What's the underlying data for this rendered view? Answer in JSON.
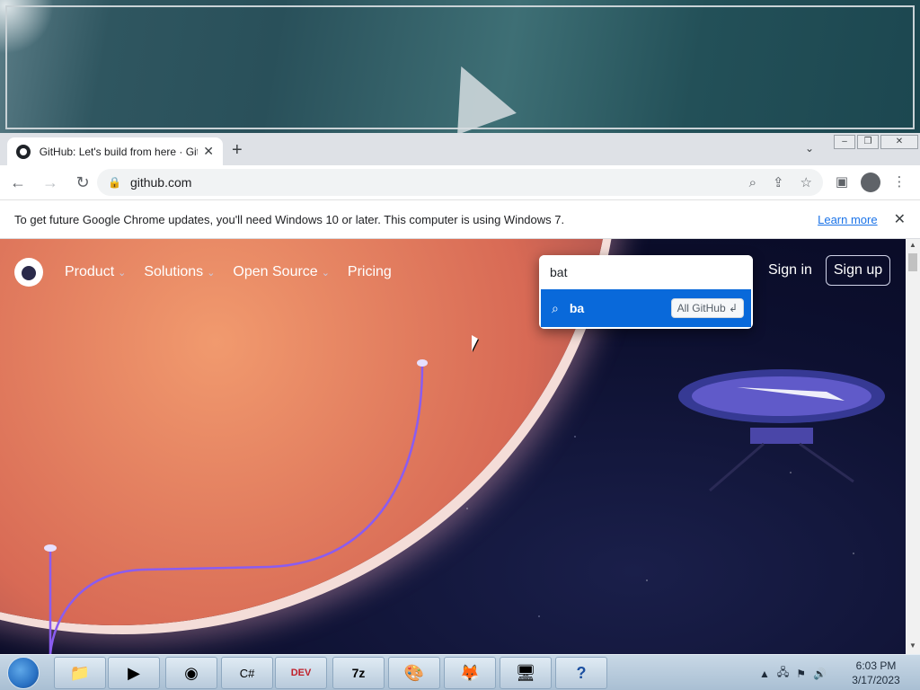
{
  "browser": {
    "tab_title": "GitHub: Let's build from here · GitHub",
    "tab_close": "✕",
    "new_tab": "+",
    "tab_menu": "⌄",
    "url": "github.com",
    "infobar_text": "To get future Google Chrome updates, you'll need Windows 10 or later. This computer is using Windows 7.",
    "infobar_link": "Learn more",
    "infobar_close": "✕"
  },
  "github": {
    "nav": [
      {
        "label": "Product",
        "caret": "⌄"
      },
      {
        "label": "Solutions",
        "caret": "⌄"
      },
      {
        "label": "Open Source",
        "caret": "⌄"
      },
      {
        "label": "Pricing",
        "caret": ""
      }
    ],
    "signin": "Sign in",
    "signup": "Sign up",
    "search_value": "bat",
    "suggestion": "ba",
    "suggestion_badge": "All GitHub ↲"
  },
  "taskbar": {
    "items": [
      {
        "name": "file-explorer",
        "glyph": "📁"
      },
      {
        "name": "media-player",
        "glyph": "▶"
      },
      {
        "name": "chrome",
        "glyph": "◉"
      },
      {
        "name": "csharp",
        "glyph": "C#"
      },
      {
        "name": "dev-cpp",
        "glyph": "DEV"
      },
      {
        "name": "7zip",
        "glyph": "7z"
      },
      {
        "name": "paint",
        "glyph": "🎨"
      },
      {
        "name": "firefox",
        "glyph": "🦊"
      },
      {
        "name": "network",
        "glyph": "🖥"
      },
      {
        "name": "help",
        "glyph": "?"
      }
    ],
    "time": "6:03 PM",
    "date": "3/17/2023"
  },
  "colors": {
    "suggest_bg": "#0969da",
    "page_bg": "#0d1030"
  }
}
